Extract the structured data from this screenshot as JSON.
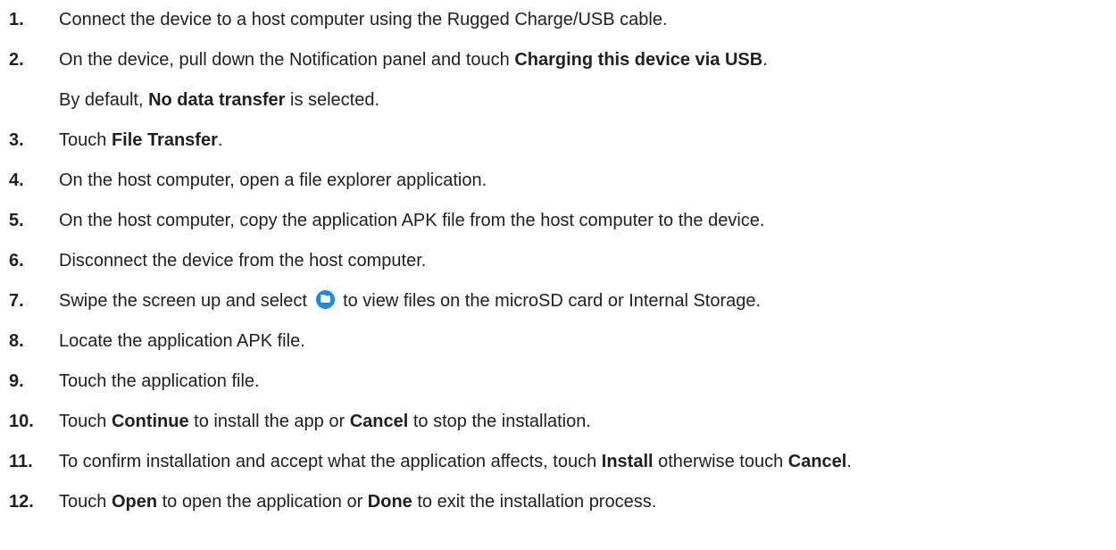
{
  "steps": [
    {
      "number": "1.",
      "parts": [
        {
          "t": "Connect the device to a host computer using the Rugged Charge/USB cable."
        }
      ]
    },
    {
      "number": "2.",
      "parts": [
        {
          "t": "On the device, pull down the Notification panel and touch "
        },
        {
          "t": "Charging this device via USB",
          "b": true
        },
        {
          "t": "."
        }
      ]
    },
    {
      "number": "",
      "parts": [
        {
          "t": "By default, "
        },
        {
          "t": "No data transfer",
          "b": true
        },
        {
          "t": " is selected."
        }
      ]
    },
    {
      "number": "3.",
      "parts": [
        {
          "t": "Touch "
        },
        {
          "t": "File Transfer",
          "b": true
        },
        {
          "t": "."
        }
      ]
    },
    {
      "number": "4.",
      "parts": [
        {
          "t": "On the host computer, open a file explorer application."
        }
      ]
    },
    {
      "number": "5.",
      "parts": [
        {
          "t": "On the host computer, copy the application APK file from the host computer to the device."
        }
      ]
    },
    {
      "number": "6.",
      "parts": [
        {
          "t": "Disconnect the device from the host computer."
        }
      ]
    },
    {
      "number": "7.",
      "parts": [
        {
          "t": "Swipe the screen up and select "
        },
        {
          "icon": "folder-icon"
        },
        {
          "t": " to view files on the microSD card or Internal Storage."
        }
      ]
    },
    {
      "number": "8.",
      "parts": [
        {
          "t": "Locate the application APK file."
        }
      ]
    },
    {
      "number": "9.",
      "parts": [
        {
          "t": "Touch the application file."
        }
      ]
    },
    {
      "number": "10.",
      "parts": [
        {
          "t": "Touch "
        },
        {
          "t": "Continue",
          "b": true
        },
        {
          "t": " to install the app or "
        },
        {
          "t": "Cancel",
          "b": true
        },
        {
          "t": " to stop the installation."
        }
      ]
    },
    {
      "number": "11.",
      "parts": [
        {
          "t": "To confirm installation and accept what the application affects, touch "
        },
        {
          "t": "Install",
          "b": true
        },
        {
          "t": " otherwise touch "
        },
        {
          "t": "Cancel",
          "b": true
        },
        {
          "t": "."
        }
      ]
    },
    {
      "number": "12.",
      "parts": [
        {
          "t": "Touch "
        },
        {
          "t": "Open",
          "b": true
        },
        {
          "t": " to open the application or "
        },
        {
          "t": "Done",
          "b": true
        },
        {
          "t": " to exit the installation process."
        }
      ]
    }
  ],
  "colors": {
    "text": "#1f1f1f",
    "icon_blue": "#1a8be3",
    "background": "#ffffff"
  }
}
